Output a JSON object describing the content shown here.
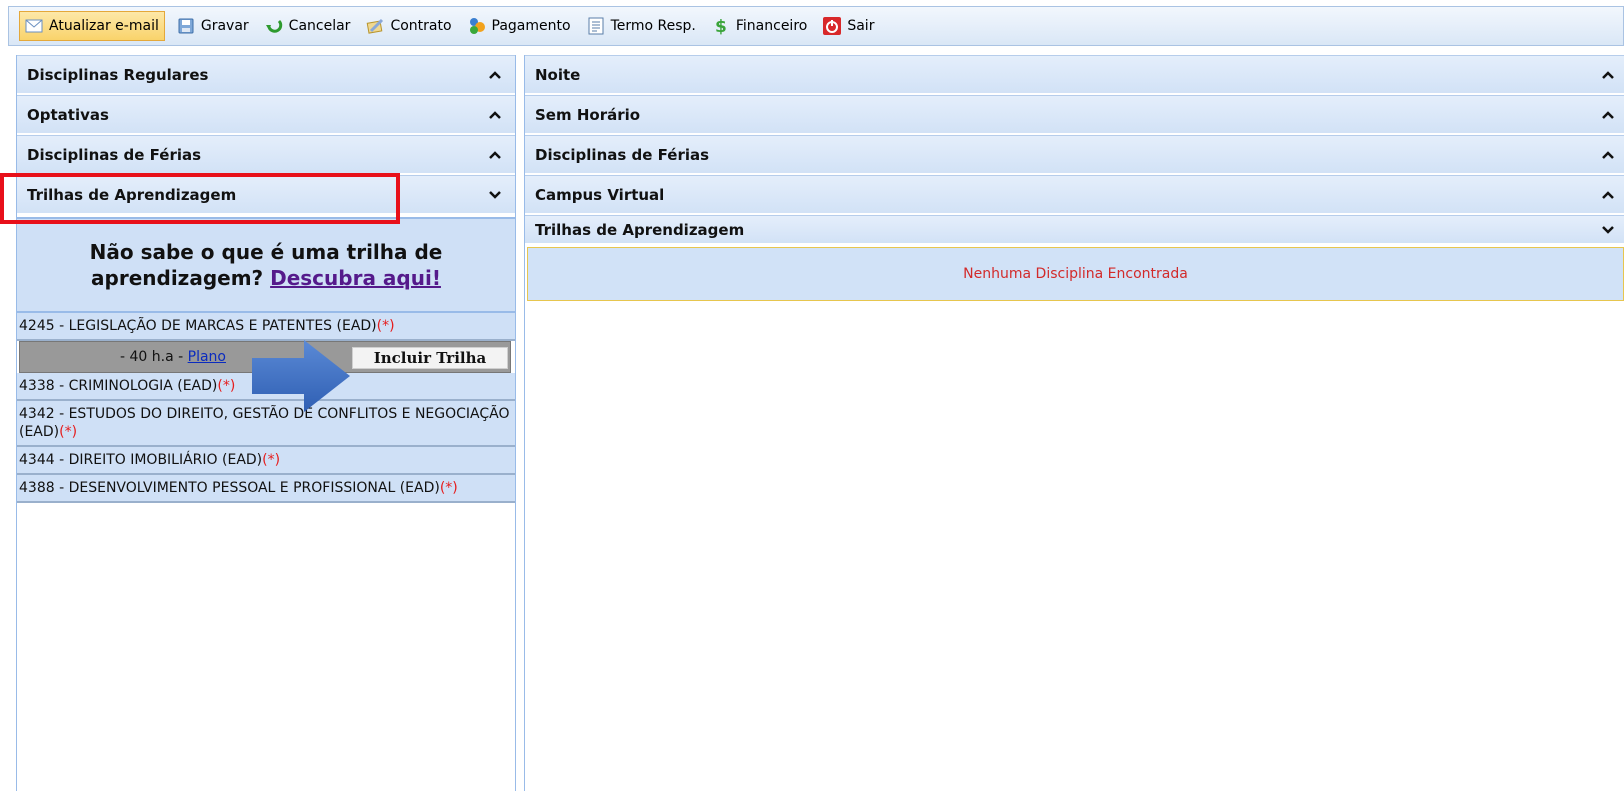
{
  "toolbar": {
    "items": [
      {
        "label": "Atualizar e-mail",
        "icon": "envelope-icon"
      },
      {
        "label": "Gravar",
        "icon": "floppy-disk-icon"
      },
      {
        "label": "Cancelar",
        "icon": "undo-arrow-icon"
      },
      {
        "label": "Contrato",
        "icon": "contract-pen-icon"
      },
      {
        "label": "Pagamento",
        "icon": "payment-icon"
      },
      {
        "label": "Termo Resp.",
        "icon": "document-icon"
      },
      {
        "label": "Financeiro",
        "icon": "dollar-icon"
      },
      {
        "label": "Sair",
        "icon": "power-icon"
      }
    ]
  },
  "left": {
    "sections": [
      {
        "label": "Disciplinas Regulares",
        "state": "collapsed"
      },
      {
        "label": "Optativas",
        "state": "collapsed"
      },
      {
        "label": "Disciplinas de Férias",
        "state": "collapsed"
      },
      {
        "label": "Trilhas de Aprendizagem",
        "state": "expanded"
      }
    ],
    "info": {
      "line1": "Não sabe o que é uma trilha de",
      "line2_prefix": "aprendizagem?",
      "link": "Descubra aqui!"
    },
    "courses": [
      {
        "text": "4245 - LEGISLAÇÃO DE MARCAS E PATENTES (EAD)",
        "mark": "(*)"
      },
      {
        "text": "4338 - CRIMINOLOGIA (EAD)",
        "mark": "(*)"
      },
      {
        "text": "4342 - ESTUDOS DO DIREITO, GESTÃO DE CONFLITOS E NEGOCIAÇÃO (EAD)",
        "mark": "(*)"
      },
      {
        "text": "4344 - DIREITO IMOBILIÁRIO (EAD)",
        "mark": "(*)"
      },
      {
        "text": "4388 - DESENVOLVIMENTO PESSOAL E PROFISSIONAL (EAD)",
        "mark": "(*)"
      }
    ],
    "detail": {
      "hours": "- 40 h.a -",
      "plano": "Plano",
      "button": "Incluir Trilha"
    }
  },
  "right": {
    "sections": [
      {
        "label": "Noite",
        "state": "collapsed"
      },
      {
        "label": "Sem Horário",
        "state": "collapsed"
      },
      {
        "label": "Disciplinas de Férias",
        "state": "collapsed"
      },
      {
        "label": "Campus Virtual",
        "state": "collapsed"
      },
      {
        "label": "Trilhas de Aprendizagem",
        "state": "expanded"
      }
    ],
    "empty_message": "Nenhuma Disciplina Encontrada"
  },
  "colors": {
    "highlight": "#e8101a",
    "arrow": "#3f6fc4",
    "asterisk": "#e61d1d",
    "empty_text": "#d22a2a"
  }
}
